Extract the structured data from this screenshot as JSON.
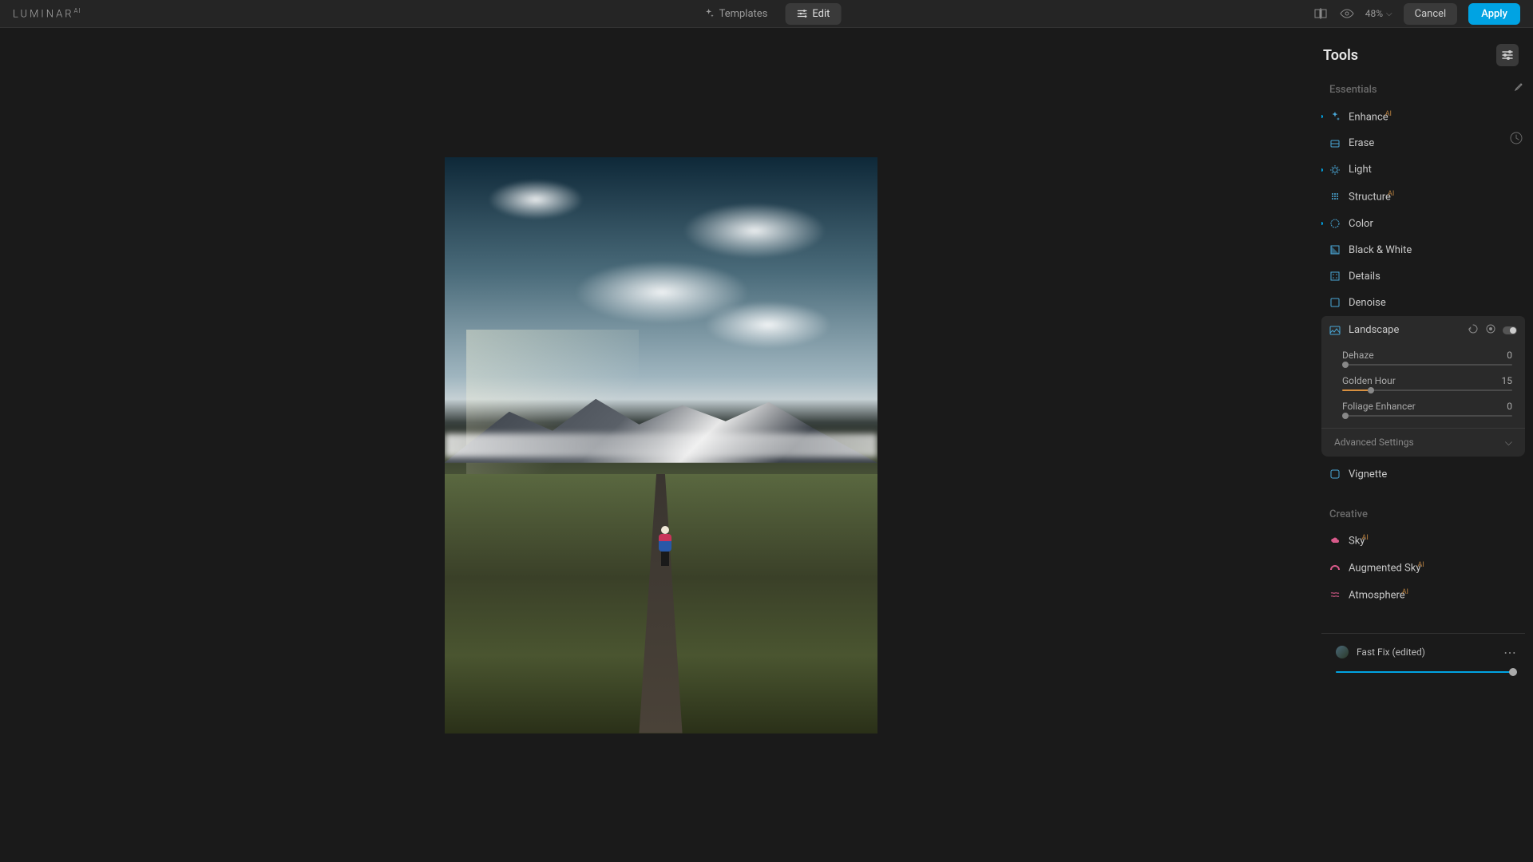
{
  "app": {
    "name": "LUMINAR",
    "suffix": "AI"
  },
  "topbar": {
    "templates_label": "Templates",
    "edit_label": "Edit",
    "zoom": "48%",
    "cancel_label": "Cancel",
    "apply_label": "Apply"
  },
  "tools": {
    "title": "Tools",
    "sections": {
      "essentials": "Essentials",
      "creative": "Creative"
    },
    "essentials_items": [
      {
        "label": "Enhance",
        "ai": true,
        "modified": true,
        "icon": "sparkle"
      },
      {
        "label": "Erase",
        "ai": false,
        "modified": false,
        "icon": "erase"
      },
      {
        "label": "Light",
        "ai": false,
        "modified": true,
        "icon": "sun"
      },
      {
        "label": "Structure",
        "ai": true,
        "modified": false,
        "icon": "grid"
      },
      {
        "label": "Color",
        "ai": false,
        "modified": true,
        "icon": "circle"
      },
      {
        "label": "Black & White",
        "ai": false,
        "modified": false,
        "icon": "half"
      },
      {
        "label": "Details",
        "ai": false,
        "modified": false,
        "icon": "dots"
      },
      {
        "label": "Denoise",
        "ai": false,
        "modified": false,
        "icon": "square"
      }
    ],
    "landscape": {
      "label": "Landscape",
      "sliders": [
        {
          "name": "Dehaze",
          "value": 0,
          "pct": 0
        },
        {
          "name": "Golden Hour",
          "value": 15,
          "pct": 15
        },
        {
          "name": "Foliage Enhancer",
          "value": 0,
          "pct": 0
        }
      ],
      "advanced": "Advanced Settings"
    },
    "vignette_label": "Vignette",
    "creative_items": [
      {
        "label": "Sky",
        "ai": true,
        "icon": "cloud"
      },
      {
        "label": "Augmented Sky",
        "ai": true,
        "icon": "rainbow"
      },
      {
        "label": "Atmosphere",
        "ai": true,
        "icon": "waves"
      }
    ]
  },
  "template": {
    "label": "Fast Fix (edited)",
    "amount": 100
  }
}
